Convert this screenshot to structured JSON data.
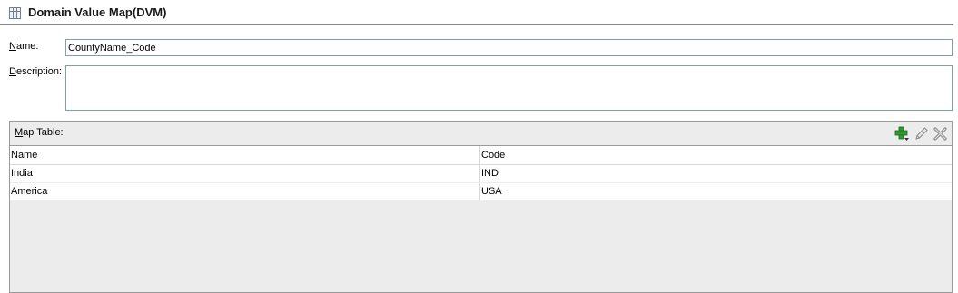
{
  "header": {
    "title": "Domain Value Map(DVM)",
    "icon": "table-grid-icon"
  },
  "form": {
    "name_label": "Name:",
    "name_access_key": "N",
    "name_value": "CountyName_Code",
    "description_label": "Description:",
    "description_access_key": "D",
    "description_value": ""
  },
  "map_table": {
    "label": "Map Table:",
    "toolbar": [
      {
        "name": "add-icon",
        "color": "#2e9b2e"
      },
      {
        "name": "edit-icon",
        "color": "#8a8a8a"
      },
      {
        "name": "delete-icon",
        "color": "#8a8a8a"
      }
    ],
    "columns": [
      "Name",
      "Code"
    ],
    "rows": [
      [
        "India",
        "IND"
      ],
      [
        "America",
        "USA"
      ]
    ]
  }
}
